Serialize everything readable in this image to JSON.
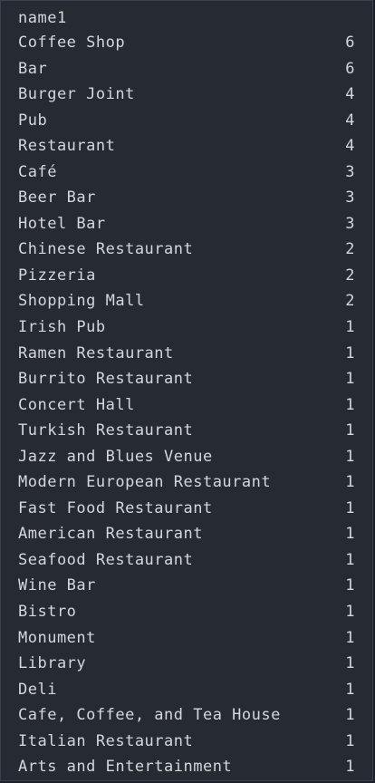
{
  "header": "name1",
  "rows": [
    {
      "label": "Coffee Shop",
      "count": "6"
    },
    {
      "label": "Bar",
      "count": "6"
    },
    {
      "label": "Burger Joint",
      "count": "4"
    },
    {
      "label": "Pub",
      "count": "4"
    },
    {
      "label": "Restaurant",
      "count": "4"
    },
    {
      "label": "Café",
      "count": "3"
    },
    {
      "label": "Beer Bar",
      "count": "3"
    },
    {
      "label": "Hotel Bar",
      "count": "3"
    },
    {
      "label": "Chinese Restaurant",
      "count": "2"
    },
    {
      "label": "Pizzeria",
      "count": "2"
    },
    {
      "label": "Shopping Mall",
      "count": "2"
    },
    {
      "label": "Irish Pub",
      "count": "1"
    },
    {
      "label": "Ramen Restaurant",
      "count": "1"
    },
    {
      "label": "Burrito Restaurant",
      "count": "1"
    },
    {
      "label": "Concert Hall",
      "count": "1"
    },
    {
      "label": "Turkish Restaurant",
      "count": "1"
    },
    {
      "label": "Jazz and Blues Venue",
      "count": "1"
    },
    {
      "label": "Modern European Restaurant",
      "count": "1"
    },
    {
      "label": "Fast Food Restaurant",
      "count": "1"
    },
    {
      "label": "American Restaurant",
      "count": "1"
    },
    {
      "label": "Seafood Restaurant",
      "count": "1"
    },
    {
      "label": "Wine Bar",
      "count": "1"
    },
    {
      "label": "Bistro",
      "count": "1"
    },
    {
      "label": "Monument",
      "count": "1"
    },
    {
      "label": "Library",
      "count": "1"
    },
    {
      "label": "Deli",
      "count": "1"
    },
    {
      "label": "Cafe, Coffee, and Tea House",
      "count": "1"
    },
    {
      "label": "Italian Restaurant",
      "count": "1"
    },
    {
      "label": "Arts and Entertainment",
      "count": "1"
    }
  ]
}
